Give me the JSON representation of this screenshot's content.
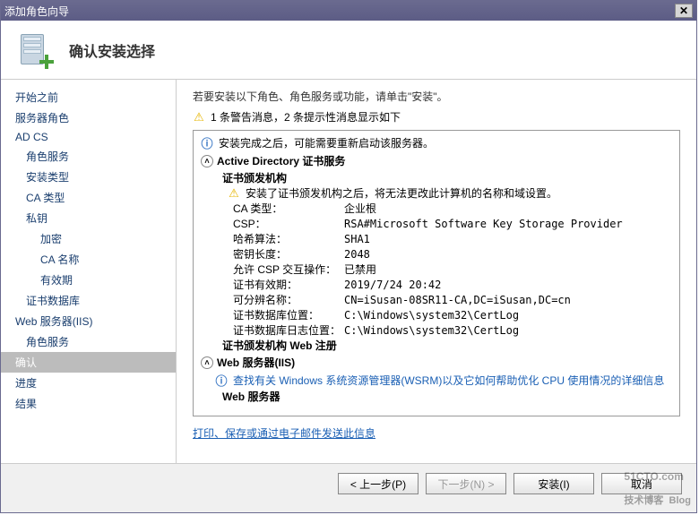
{
  "window": {
    "title": "添加角色向导"
  },
  "header": {
    "title": "确认安装选择"
  },
  "nav": {
    "items": [
      {
        "label": "开始之前",
        "level": 0
      },
      {
        "label": "服务器角色",
        "level": 0
      },
      {
        "label": "AD CS",
        "level": 0
      },
      {
        "label": "角色服务",
        "level": 1
      },
      {
        "label": "安装类型",
        "level": 1
      },
      {
        "label": "CA 类型",
        "level": 1
      },
      {
        "label": "私钥",
        "level": 1
      },
      {
        "label": "加密",
        "level": 2
      },
      {
        "label": "CA 名称",
        "level": 2
      },
      {
        "label": "有效期",
        "level": 2
      },
      {
        "label": "证书数据库",
        "level": 1
      },
      {
        "label": "Web 服务器(IIS)",
        "level": 0
      },
      {
        "label": "角色服务",
        "level": 1
      },
      {
        "label": "确认",
        "level": 0,
        "selected": true
      },
      {
        "label": "进度",
        "level": 0
      },
      {
        "label": "结果",
        "level": 0
      }
    ]
  },
  "content": {
    "intro": "若要安装以下角色、角色服务或功能，请单击\"安装\"。",
    "warning_counts": "1 条警告消息，2 条提示性消息显示如下",
    "restart_info": "安装完成之后，可能需要重新启动该服务器。",
    "section_adcs": "Active Directory 证书服务",
    "sub_ca": "证书颁发机构",
    "ca_warn": "安装了证书颁发机构之后，将无法更改此计算机的名称和域设置。",
    "rows": [
      {
        "k": "CA 类型：",
        "v": "企业根"
      },
      {
        "k": "CSP：",
        "v": "RSA#Microsoft Software Key Storage Provider"
      },
      {
        "k": "哈希算法：",
        "v": "SHA1"
      },
      {
        "k": "密钥长度：",
        "v": "2048"
      },
      {
        "k": "允许 CSP 交互操作：",
        "v": "已禁用"
      },
      {
        "k": "证书有效期：",
        "v": "2019/7/24 20:42"
      },
      {
        "k": "可分辨名称：",
        "v": "CN=iSusan-08SR11-CA,DC=iSusan,DC=cn"
      },
      {
        "k": "证书数据库位置：",
        "v": "C:\\Windows\\system32\\CertLog"
      },
      {
        "k": "证书数据库日志位置：",
        "v": "C:\\Windows\\system32\\CertLog"
      }
    ],
    "sub_ca_webreg": "证书颁发机构 Web 注册",
    "section_iis": "Web 服务器(IIS)",
    "iis_info": "查找有关 Windows 系统资源管理器(WSRM)以及它如何帮助优化 CPU 使用情况的详细信息",
    "sub_webserver": "Web 服务器",
    "print_link": "打印、保存或通过电子邮件发送此信息"
  },
  "buttons": {
    "prev": "< 上一步(P)",
    "next": "下一步(N) >",
    "install": "安装(I)",
    "cancel": "取消"
  },
  "watermark": {
    "main": "51CTO.com",
    "sub": "技术博客",
    "tag": "Blog"
  }
}
